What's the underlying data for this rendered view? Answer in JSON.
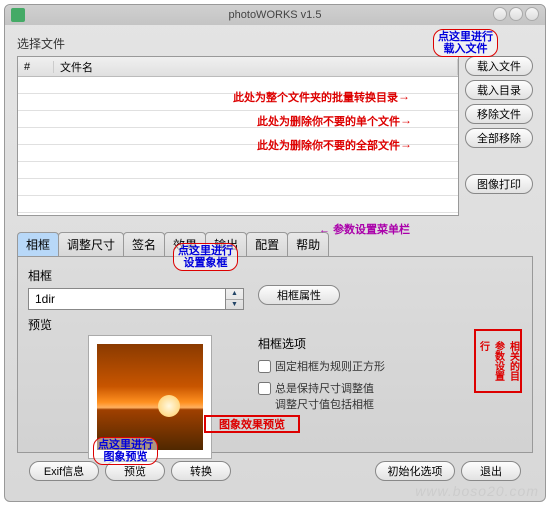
{
  "title": "photoWORKS v1.5",
  "select_files_label": "选择文件",
  "table": {
    "col_num": "#",
    "col_name": "文件名"
  },
  "side_buttons": {
    "load_files": "载入文件",
    "load_dir": "载入目录",
    "remove_file": "移除文件",
    "remove_all": "全部移除",
    "print": "图像打印"
  },
  "annotations": {
    "top_right": "点这里进行\n载入文件",
    "hint_dir": "此处为整个文件夹的批量转换目录",
    "hint_remove_one": "此处为删除你不要的单个文件",
    "hint_remove_all": "此处为删除你不要的全部文件",
    "tabs_hint": "参数设置菜单栏",
    "frame_set": "点这里进行\n设置象框",
    "img_effect": "图象效果预览",
    "img_preview": "点这里进行\n图象预览",
    "side_opts": "相关的目\n参数设置\n行"
  },
  "tabs": [
    "相框",
    "调整尺寸",
    "签名",
    "效果",
    "输出",
    "配置",
    "帮助"
  ],
  "active_tab": 0,
  "frame": {
    "group_label": "相框",
    "combo_value": "1dir",
    "props_button": "相框属性",
    "preview_label": "预览",
    "options_label": "相框选项",
    "opt1": "固定相框为规则正方形",
    "opt2": "总是保持尺寸调整值\n调整尺寸值包括相框",
    "opt1_checked": false,
    "opt2_checked": false
  },
  "bottom": {
    "exif": "Exif信息",
    "preview": "预览",
    "convert": "转换",
    "init": "初始化选项",
    "exit": "退出"
  },
  "watermark": "www.boso20.com"
}
